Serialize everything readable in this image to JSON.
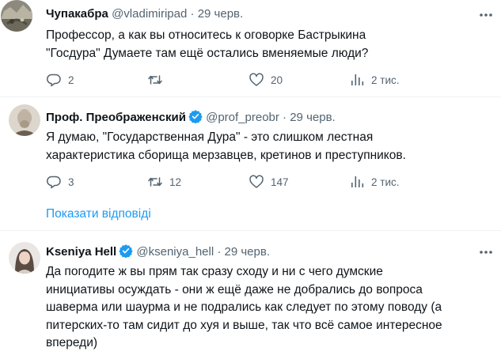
{
  "tweets": [
    {
      "name": "Чупакабра",
      "handle": "@vladimiripad",
      "separator": "·",
      "date": "29 черв.",
      "verified": false,
      "text": "Профессор, а как вы относитесь к оговорке Бастрыкина\n\"Госдура\" Думаете там ещё остались вменяемые люди?",
      "stats": {
        "replies": "2",
        "retweets": "",
        "likes": "20",
        "views": "2 тис."
      }
    },
    {
      "name": "Проф. Преображенский",
      "handle": "@prof_preobr",
      "separator": "·",
      "date": "29 черв.",
      "verified": true,
      "text": "Я думаю, \"Государственная Дура\" - это слишком лестная\nхарактеристика сборища мерзавцев, кретинов и преступников.",
      "stats": {
        "replies": "3",
        "retweets": "12",
        "likes": "147",
        "views": "2 тис."
      }
    },
    {
      "name": "Kseniya Hell",
      "handle": "@kseniya_hell",
      "separator": "·",
      "date": "29 черв.",
      "verified": true,
      "text": "Да погодите ж вы прям так сразу сходу и ни с чего думские\nинициативы осуждать - они ж ещё даже не добрались до вопроса\nшаверма или шаурма и не подрались как следует по этому поводу (а\nпитерских-то там сидит до хуя и выше, так что всё самое интересное\nвпереди)"
    }
  ],
  "show_replies": "Показати відповіді",
  "colors": {
    "text": "#0f1419",
    "secondary": "#536471",
    "accent": "#1d9bf0",
    "divider": "#eff3f4"
  },
  "icons": [
    "more-icon",
    "reply-icon",
    "retweet-icon",
    "like-icon",
    "views-icon",
    "verified-badge-icon"
  ]
}
